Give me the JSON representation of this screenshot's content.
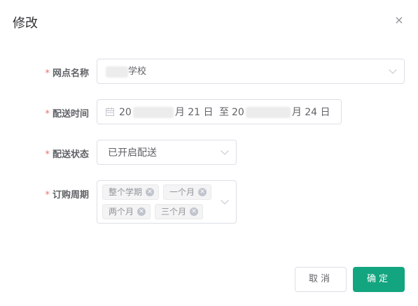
{
  "dialog": {
    "title": "修改",
    "close_glyph": "×"
  },
  "form": {
    "required_mark": "*",
    "site_name": {
      "label": "网点名称",
      "value_suffix": "学校"
    },
    "delivery_time": {
      "label": "配送时间",
      "start_prefix": "20",
      "start_suffix": "月 21 日",
      "separator": "至",
      "end_prefix": "20",
      "end_suffix": "月 24 日"
    },
    "delivery_status": {
      "label": "配送状态",
      "value": "已开启配送"
    },
    "order_period": {
      "label": "订购周期",
      "tags": [
        "整个学期",
        "一个月",
        "两个月",
        "三个月"
      ],
      "tag_close_glyph": "✕"
    }
  },
  "footer": {
    "cancel_label": "取消",
    "confirm_label": "确定"
  },
  "colors": {
    "primary": "#13a57f",
    "required": "#f56c6c"
  }
}
